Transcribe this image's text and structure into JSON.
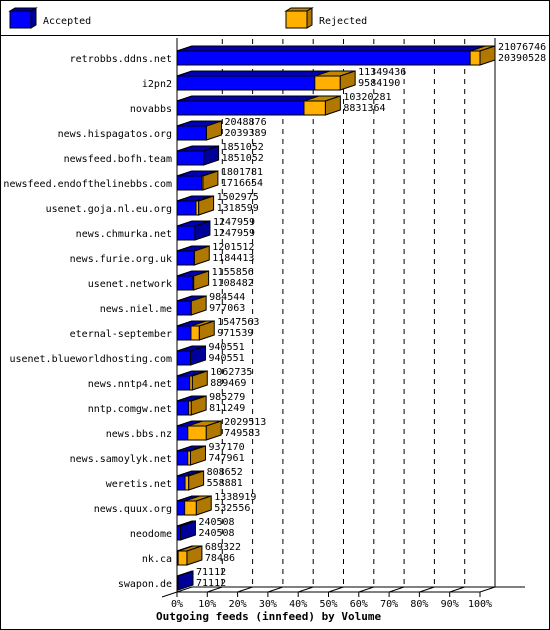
{
  "chart_data": {
    "type": "bar",
    "orientation": "horizontal",
    "stacked": true,
    "title": "Outgoing feeds (innfeed) by Volume",
    "xlabel": "",
    "ylabel": "",
    "xlim_percent": [
      0,
      100
    ],
    "x_tick_labels": [
      "0%",
      "10%",
      "20%",
      "30%",
      "40%",
      "50%",
      "60%",
      "70%",
      "80%",
      "90%",
      "100%"
    ],
    "grid": "vertical dashed",
    "legend_position": "top",
    "legend": [
      {
        "name": "Accepted",
        "color": "#0000ff",
        "side_color": "#000099",
        "top_color": "#0000b0"
      },
      {
        "name": "Rejected",
        "color": "#ffb000",
        "side_color": "#b07800",
        "top_color": "#c08800"
      }
    ],
    "categories": [
      "retrobbs.ddns.net",
      "i2pn2",
      "novabbs",
      "news.hispagatos.org",
      "newsfeed.bofh.team",
      "newsfeed.endofthelinebbs.com",
      "usenet.goja.nl.eu.org",
      "news.chmurka.net",
      "news.furie.org.uk",
      "usenet.network",
      "news.niel.me",
      "eternal-september",
      "usenet.blueworldhosting.com",
      "news.nntp4.net",
      "nntp.comgw.net",
      "news.bbs.nz",
      "news.samoylyk.net",
      "weretis.net",
      "news.quux.org",
      "neodome",
      "nk.ca",
      "swapon.de"
    ],
    "totals": [
      21076746,
      11349436,
      10320281,
      2048876,
      1851052,
      1801781,
      1502975,
      1247959,
      1201512,
      1155856,
      984544,
      1547563,
      940551,
      1062735,
      985279,
      2029513,
      937170,
      808652,
      1338919,
      240508,
      689322,
      71112
    ],
    "accepted": [
      20390528,
      9584190,
      8831364,
      2039389,
      1851052,
      1716654,
      1318599,
      1247959,
      1184413,
      1108482,
      977063,
      971539,
      940551,
      889469,
      811249,
      749583,
      747961,
      558881,
      532556,
      240508,
      78486,
      71112
    ],
    "series": [
      {
        "name": "Accepted",
        "values": [
          20390528,
          9584190,
          8831364,
          2039389,
          1851052,
          1716654,
          1318599,
          1247959,
          1184413,
          1108482,
          977063,
          971539,
          940551,
          889469,
          811249,
          749583,
          747961,
          558881,
          532556,
          240508,
          78486,
          71112
        ]
      },
      {
        "name": "Rejected",
        "values": [
          686218,
          1765246,
          1488917,
          9487,
          0,
          85127,
          184376,
          0,
          17099,
          47374,
          7481,
          576024,
          0,
          173266,
          174030,
          1279930,
          189209,
          249771,
          806363,
          0,
          610836,
          0
        ]
      }
    ]
  }
}
